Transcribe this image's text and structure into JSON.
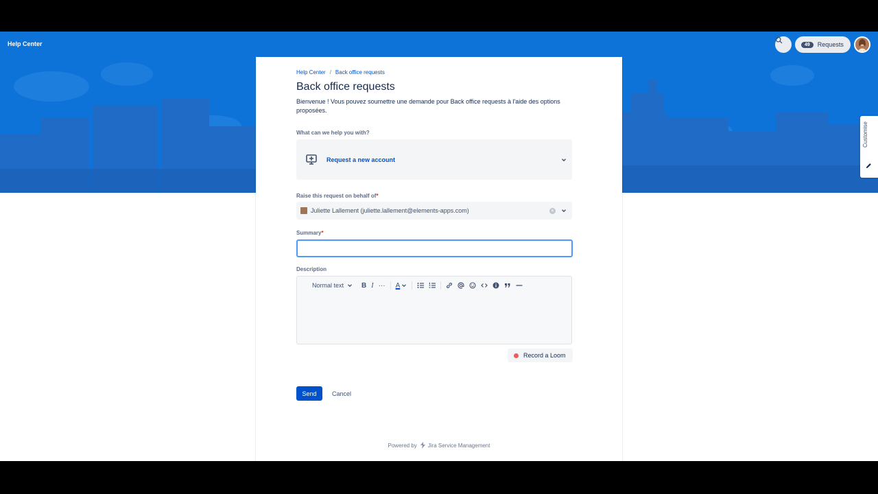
{
  "header": {
    "title": "Help Center",
    "requests_count": "49",
    "requests_label": "Requests"
  },
  "side_tab": {
    "label": "Customise"
  },
  "breadcrumb": {
    "items": [
      "Help Center",
      "Back office requests"
    ],
    "separator": "/"
  },
  "page": {
    "title": "Back office requests",
    "intro": "Bienvenue ! Vous pouvez soumettre une demande pour Back office requests à l'aide des options proposées."
  },
  "form": {
    "type_label": "What can we help you with?",
    "type_value": "Request a new account",
    "behalf_label": "Raise this request on behalf of",
    "behalf_value": "Juliette Lallement (juliette.lallement@elements-apps.com)",
    "summary_label": "Summary",
    "summary_value": "",
    "description_label": "Description",
    "required_mark": "*"
  },
  "editor_toolbar": {
    "text_style": "Normal text",
    "bold": "B",
    "italic": "I",
    "more": "···",
    "color": "A"
  },
  "loom": {
    "label": "Record a Loom"
  },
  "actions": {
    "send": "Send",
    "cancel": "Cancel"
  },
  "footer": {
    "powered_by": "Powered by",
    "product": "Jira Service Management"
  },
  "colors": {
    "banner": "#0e73d9",
    "primary": "#0052cc",
    "focus": "#4c9aff",
    "required": "#de350b"
  }
}
